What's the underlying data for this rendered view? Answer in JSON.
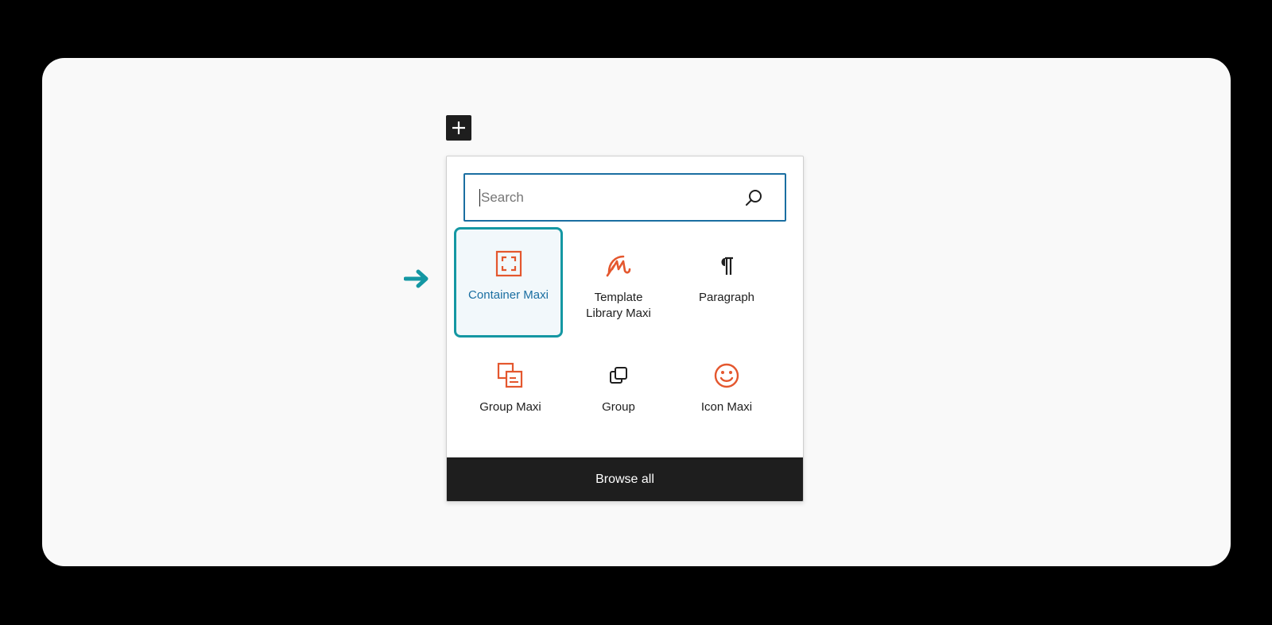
{
  "search": {
    "placeholder": "Search"
  },
  "blocks": [
    {
      "label": "Container Maxi",
      "icon": "container-maxi-icon",
      "selected": true
    },
    {
      "label": "Template Library Maxi",
      "icon": "template-library-maxi-icon"
    },
    {
      "label": "Paragraph",
      "icon": "paragraph-icon"
    },
    {
      "label": "Group Maxi",
      "icon": "group-maxi-icon"
    },
    {
      "label": "Group",
      "icon": "group-icon"
    },
    {
      "label": "Icon Maxi",
      "icon": "icon-maxi-icon"
    }
  ],
  "footer": {
    "browse_all_label": "Browse all"
  },
  "colors": {
    "accent": "#1497a3",
    "maxi_orange": "#e4572e",
    "focus_blue": "#1a6ea1",
    "dark": "#1e1e1e"
  }
}
